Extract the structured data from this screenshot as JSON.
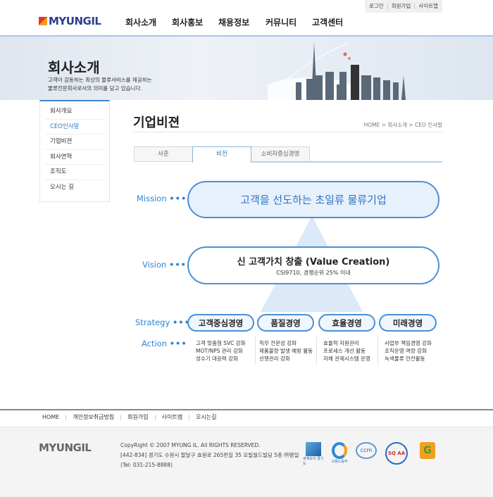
{
  "util_links": [
    "로그인",
    "회원가입",
    "사이트맵"
  ],
  "logo": "MYUNGIL",
  "nav": [
    "회사소개",
    "회사홍보",
    "채용정보",
    "커뮤니티",
    "고객센터"
  ],
  "banner": {
    "title": "회사소개",
    "sub1": "고객이 감동하는 최상의 물류서비스를 제공하는",
    "sub2": "물류전문회사로서의 의미를 담고 있습니다."
  },
  "sidebar": [
    {
      "label": "회사개요"
    },
    {
      "label": "CEO인사말",
      "active": true
    },
    {
      "label": "기업비젼"
    },
    {
      "label": "회사연혁"
    },
    {
      "label": "조직도"
    },
    {
      "label": "오시는 길"
    }
  ],
  "page_title": "기업비젼",
  "breadcrumb": "HOME  >  회사소개  >  CEO 인사말",
  "tabs": [
    {
      "label": "사훈"
    },
    {
      "label": "비전",
      "active": true
    },
    {
      "label": "소비자중심경영"
    }
  ],
  "vision": {
    "mission_label": "Mission",
    "mission": "고객을 선도하는 초일류 물류기업",
    "vision_label": "Vision",
    "vision": "신 고객가치 창출 (Value Creation)",
    "vision_sub": "CSI9710, 경쟁순위 25% 이내",
    "strategy_label": "Strategy",
    "action_label": "Action",
    "dots": "•••",
    "strategies": [
      {
        "name": "고객중심경영",
        "actions": [
          "고객 맞춤형 SVC 강화",
          "MOT/NPS 관리 강화",
          "성수기 대응력 강화"
        ]
      },
      {
        "name": "품질경영",
        "actions": [
          "직무 전문성 강화",
          "제품불량 발생 예방 활동",
          "선행관리 강화"
        ]
      },
      {
        "name": "효율경영",
        "actions": [
          "효율적 자원관리",
          "프로세스 개선 활동",
          "자체 관제시스템 운영"
        ]
      },
      {
        "name": "미래경영",
        "actions": [
          "사업부 책임경영 강화",
          "조직운영 역량 강화",
          "녹색물류 안전활동"
        ]
      }
    ]
  },
  "footer": {
    "links": [
      "HOME",
      "개인정보취급방침",
      "회원가입",
      "사이트맵",
      "오시는길"
    ],
    "logo": "MYUNGIL",
    "copyright": "CopyRight © 2007 MYUNG IL. All RIGHTS RESERVED.",
    "address": "[442-834] 경기도 수원시 팔달구 효원로 265번길 35 모빌월드빌딩 5층 ㈜명일",
    "tel": "(Tel: 031-215-8888)",
    "badges": [
      {
        "label": "세계속의 경기도",
        "color": "#2a7ac9"
      },
      {
        "label": "고용노동부",
        "color": "#2a7ac9"
      },
      {
        "label": "ccm",
        "color": "#2a7ac9"
      },
      {
        "label": "SQ AA",
        "color": "#d02b2b"
      },
      {
        "label": "G",
        "color": "#e88a1a"
      }
    ]
  }
}
